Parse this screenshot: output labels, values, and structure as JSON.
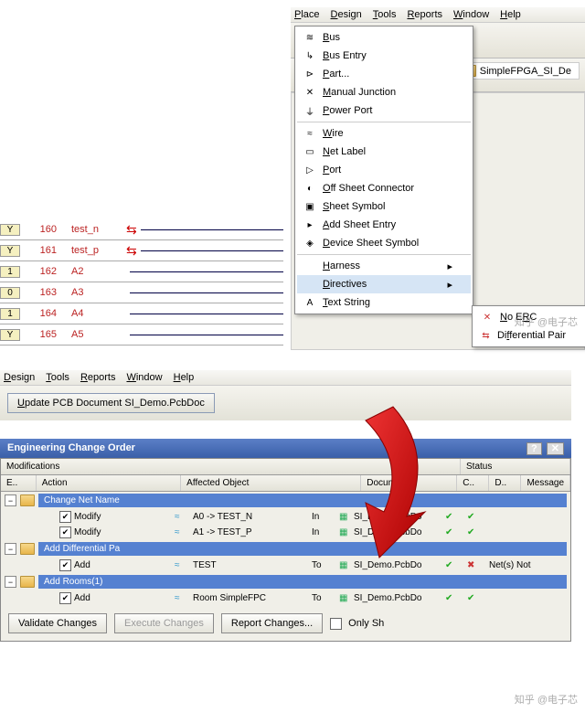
{
  "topMenuBar": {
    "items": [
      "Place",
      "Design",
      "Tools",
      "Reports",
      "Window",
      "Help"
    ]
  },
  "placeMenu": {
    "items": [
      {
        "icon": "≋",
        "label": "Bus"
      },
      {
        "icon": "↳",
        "label": "Bus Entry"
      },
      {
        "icon": "⊳",
        "label": "Part..."
      },
      {
        "icon": "✕",
        "label": "Manual Junction"
      },
      {
        "icon": "⏚",
        "label": "Power Port"
      },
      {
        "icon": "≈",
        "label": "Wire"
      },
      {
        "icon": "▭",
        "label": "Net Label"
      },
      {
        "icon": "▷",
        "label": "Port"
      },
      {
        "icon": "◐",
        "label": "Off Sheet Connector"
      },
      {
        "icon": "▣",
        "label": "Sheet Symbol"
      },
      {
        "icon": "▸",
        "label": "Add Sheet Entry"
      },
      {
        "icon": "◈",
        "label": "Device Sheet Symbol"
      },
      {
        "icon": "",
        "label": "Harness",
        "sub": true
      },
      {
        "icon": "",
        "label": "Directives",
        "sub": true,
        "hl": true
      },
      {
        "icon": "A",
        "label": "Text String"
      }
    ]
  },
  "directivesSub": [
    {
      "icon": "✕",
      "label": "No ERC"
    },
    {
      "icon": "⇆",
      "label": "Differential Pair"
    }
  ],
  "folderTab": "SimpleFPGA_SI_De",
  "schematic": {
    "rows": [
      {
        "pin": "Y",
        "num": "160",
        "net": "test_n",
        "diff": true
      },
      {
        "pin": "Y",
        "num": "161",
        "net": "test_p",
        "diff": true
      },
      {
        "pin": "1",
        "num": "162",
        "net": "A2"
      },
      {
        "pin": "0",
        "num": "163",
        "net": "A3"
      },
      {
        "pin": "1",
        "num": "164",
        "net": "A4"
      },
      {
        "pin": "Y",
        "num": "165",
        "net": "A5"
      }
    ]
  },
  "menubar2": {
    "items": [
      "Design",
      "Tools",
      "Reports",
      "Window",
      "Help"
    ]
  },
  "updateBtn": "Update PCB Document SI_Demo.PcbDoc",
  "eco": {
    "title": "Engineering Change Order",
    "sections": {
      "mods": "Modifications",
      "status": "Status"
    },
    "cols": {
      "en": "E..",
      "action": "Action",
      "obj": "Affected Object",
      "doc": "Document",
      "c": "C..",
      "d": "D..",
      "msg": "Message"
    },
    "groups": [
      {
        "name": "Change Net Name",
        "rows": [
          {
            "action": "Modify",
            "obj": "A0 -> TEST_N",
            "prep": "In",
            "doc": "SI_Demo.PcbDo",
            "c": "✔",
            "d": "✔"
          },
          {
            "action": "Modify",
            "obj": "A1 -> TEST_P",
            "prep": "In",
            "doc": "SI_Demo.PcbDo",
            "c": "✔",
            "d": "✔"
          }
        ]
      },
      {
        "name": "Add Differential Pa",
        "rows": [
          {
            "action": "Add",
            "obj": "TEST",
            "prep": "To",
            "doc": "SI_Demo.PcbDo",
            "c": "✔",
            "d": "✖",
            "msg": "Net(s) Not"
          }
        ]
      },
      {
        "name": "Add Rooms(1)",
        "rows": [
          {
            "action": "Add",
            "obj": "Room SimpleFPC",
            "prep": "To",
            "doc": "SI_Demo.PcbDo",
            "c": "✔",
            "d": "✔"
          }
        ]
      }
    ],
    "buttons": {
      "validate": "Validate Changes",
      "execute": "Execute Changes",
      "report": "Report Changes...",
      "only": "Only Sh"
    }
  },
  "watermarks": {
    "w1": "知乎 @电子芯",
    "w2": "知乎 @电子芯"
  }
}
